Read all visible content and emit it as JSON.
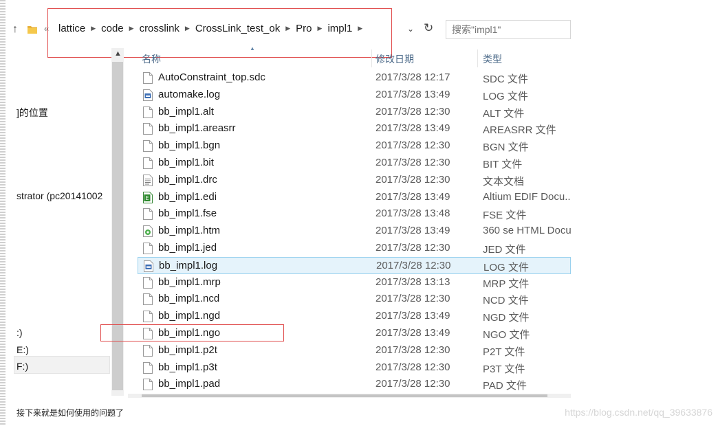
{
  "navigation": {
    "up_arrow": "↑",
    "overflow": "«",
    "breadcrumb": [
      "lattice",
      "code",
      "crosslink",
      "CrossLink_test_ok",
      "Pro",
      "impl1"
    ],
    "dropdown": "⌄",
    "refresh": "↻",
    "search_placeholder": "搜索\"impl1\""
  },
  "nav_pane": {
    "items": [
      "]的位置",
      "strator (pc20141002",
      ":)",
      "E:)",
      "F:)"
    ]
  },
  "columns": {
    "name": "名称",
    "modified": "修改日期",
    "type": "类型"
  },
  "files": [
    {
      "name": "AutoConstraint_top.sdc",
      "date": "2017/3/28 12:17",
      "type": "SDC 文件",
      "icon": "blank-file-icon"
    },
    {
      "name": "automake.log",
      "date": "2017/3/28 13:49",
      "type": "LOG 文件",
      "icon": "log-file-icon"
    },
    {
      "name": "bb_impl1.alt",
      "date": "2017/3/28 12:30",
      "type": "ALT 文件",
      "icon": "blank-file-icon"
    },
    {
      "name": "bb_impl1.areasrr",
      "date": "2017/3/28 13:49",
      "type": "AREASRR 文件",
      "icon": "blank-file-icon"
    },
    {
      "name": "bb_impl1.bgn",
      "date": "2017/3/28 12:30",
      "type": "BGN 文件",
      "icon": "blank-file-icon"
    },
    {
      "name": "bb_impl1.bit",
      "date": "2017/3/28 12:30",
      "type": "BIT 文件",
      "icon": "blank-file-icon"
    },
    {
      "name": "bb_impl1.drc",
      "date": "2017/3/28 12:30",
      "type": "文本文档",
      "icon": "text-file-icon"
    },
    {
      "name": "bb_impl1.edi",
      "date": "2017/3/28 13:49",
      "type": "Altium EDIF Docu...",
      "icon": "edif-file-icon"
    },
    {
      "name": "bb_impl1.fse",
      "date": "2017/3/28 13:48",
      "type": "FSE 文件",
      "icon": "blank-file-icon"
    },
    {
      "name": "bb_impl1.htm",
      "date": "2017/3/28 13:49",
      "type": "360 se HTML Docu",
      "icon": "html-file-icon"
    },
    {
      "name": "bb_impl1.jed",
      "date": "2017/3/28 12:30",
      "type": "JED 文件",
      "icon": "blank-file-icon"
    },
    {
      "name": "bb_impl1.log",
      "date": "2017/3/28 12:30",
      "type": "LOG 文件",
      "icon": "log-file-icon",
      "selected": true
    },
    {
      "name": "bb_impl1.mrp",
      "date": "2017/3/28 13:13",
      "type": "MRP 文件",
      "icon": "blank-file-icon"
    },
    {
      "name": "bb_impl1.ncd",
      "date": "2017/3/28 12:30",
      "type": "NCD 文件",
      "icon": "blank-file-icon"
    },
    {
      "name": "bb_impl1.ngd",
      "date": "2017/3/28 13:49",
      "type": "NGD 文件",
      "icon": "blank-file-icon"
    },
    {
      "name": "bb_impl1.ngo",
      "date": "2017/3/28 13:49",
      "type": "NGO 文件",
      "icon": "blank-file-icon"
    },
    {
      "name": "bb_impl1.p2t",
      "date": "2017/3/28 12:30",
      "type": "P2T 文件",
      "icon": "blank-file-icon"
    },
    {
      "name": "bb_impl1.p3t",
      "date": "2017/3/28 12:30",
      "type": "P3T 文件",
      "icon": "blank-file-icon"
    },
    {
      "name": "bb_impl1.pad",
      "date": "2017/3/28 12:30",
      "type": "PAD 文件",
      "icon": "blank-file-icon"
    }
  ],
  "caption": "接下来就是如何使用的问题了",
  "watermark": "https://blog.csdn.net/qq_39633876",
  "colors": {
    "selection_bg": "#e5f3fb",
    "selection_border": "#99d1ee",
    "annotation_red": "#e04a4a",
    "header_text": "#4d6b8a"
  }
}
